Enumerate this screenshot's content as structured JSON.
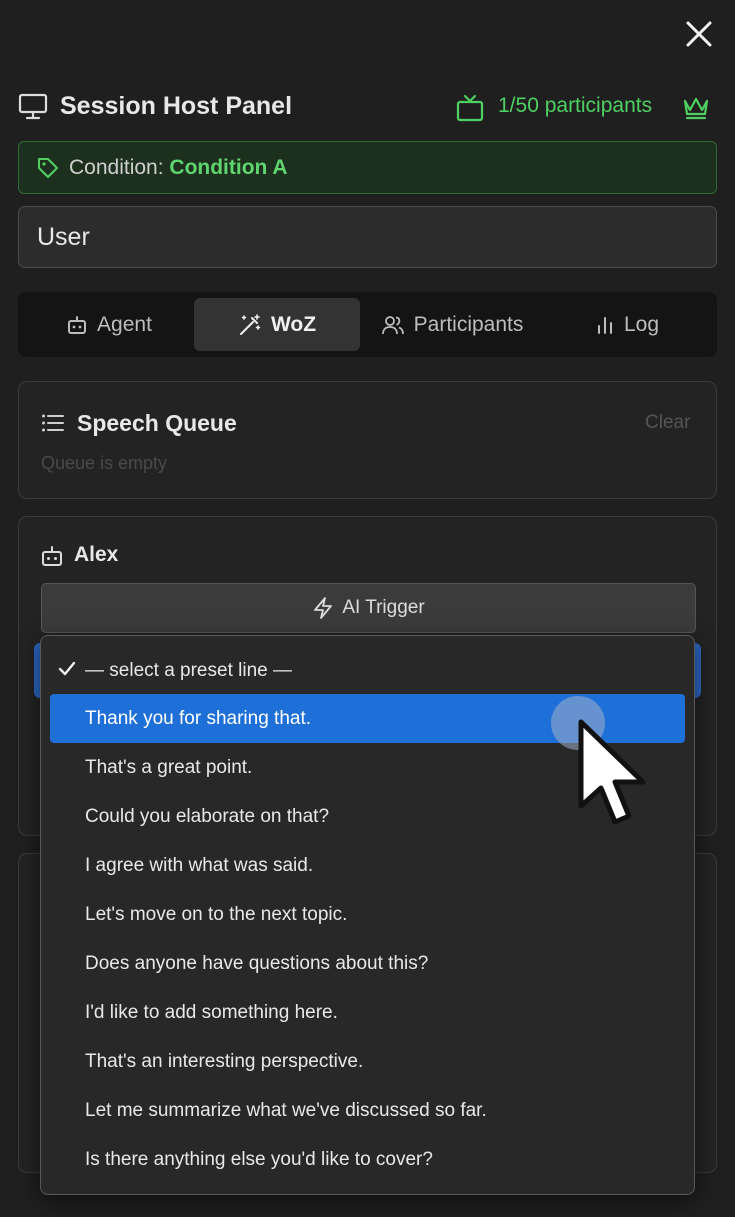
{
  "header": {
    "title": "Session Host Panel",
    "participants": "1/50 participants"
  },
  "condition": {
    "label": "Condition:",
    "value": "Condition A"
  },
  "user_field": {
    "value": "User"
  },
  "tabs": [
    {
      "label": "Agent",
      "icon": "robot-icon"
    },
    {
      "label": "WoZ",
      "icon": "magic-wand-icon",
      "active": true
    },
    {
      "label": "Participants",
      "icon": "users-icon"
    },
    {
      "label": "Log",
      "icon": "bar-chart-icon"
    }
  ],
  "speech_queue": {
    "title": "Speech Queue",
    "clear_label": "Clear",
    "empty_text": "Queue is empty"
  },
  "agent_card": {
    "name": "Alex",
    "trigger_label": "AI Trigger"
  },
  "preset_dropdown": {
    "placeholder": "— select a preset line —",
    "options": [
      "Thank you for sharing that.",
      "That's a great point.",
      "Could you elaborate on that?",
      "I agree with what was said.",
      "Let's move on to the next topic.",
      "Does anyone have questions about this?",
      "I'd like to add something here.",
      "That's an interesting perspective.",
      "Let me summarize what we've discussed so far.",
      "Is there anything else you'd like to cover?"
    ],
    "highlighted_index": 0
  },
  "colors": {
    "accent_green": "#4fd062",
    "highlight_blue": "#1f6fd8",
    "background": "#1f1f1f"
  }
}
